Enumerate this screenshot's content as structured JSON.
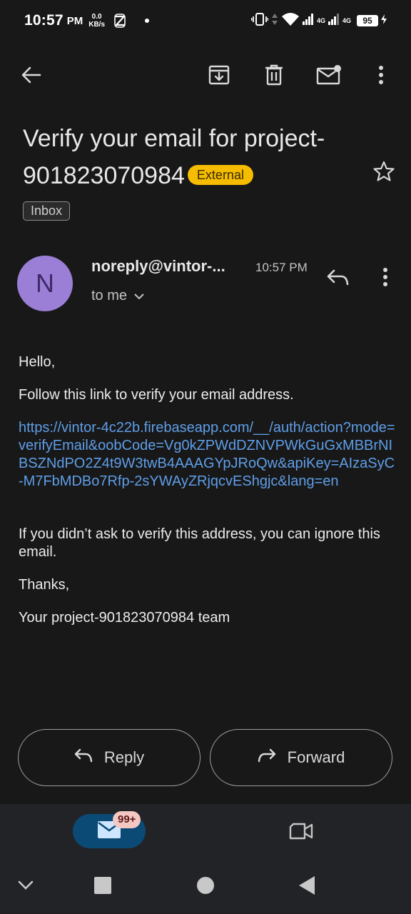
{
  "status_bar": {
    "time": "10:57",
    "ampm": "PM",
    "speed_value": "0.0",
    "speed_unit": "KB/s",
    "net1": "4G",
    "net2": "4G",
    "battery": "95"
  },
  "subject": {
    "title": "Verify your email for project-901823070984",
    "external_label": "External",
    "inbox_label": "Inbox"
  },
  "sender": {
    "avatar_letter": "N",
    "name": "noreply@vintor-...",
    "time": "10:57 PM",
    "recipient": "to me"
  },
  "body": {
    "greeting": "Hello,",
    "line1": "Follow this link to verify your email address.",
    "link": "https://vintor-4c22b.firebaseapp.com/__/auth/action?mode=verifyEmail&oobCode=Vg0kZPWdDZNVPWkGuGxMBBrNIBSZNdPO2Z4t9W3twB4AAAGYpJRoQw&apiKey=AIzaSyC-M7FbMDBo7Rfp-2sYWAyZRjqcvEShgjc&lang=en",
    "ignore_text": "If you didn’t ask to verify this address, you can ignore this email.",
    "thanks": "Thanks,",
    "signature": "Your project-901823070984 team"
  },
  "actions": {
    "reply_label": "Reply",
    "forward_label": "Forward"
  },
  "bottom_nav": {
    "mail_badge": "99+"
  },
  "colors": {
    "background": "#181818",
    "link": "#5f9ee8",
    "external_chip": "#f5bc00",
    "avatar": "#9b7fd6",
    "mail_pill": "#0b4a75"
  },
  "icons": [
    "back-arrow-icon",
    "archive-icon",
    "trash-icon",
    "mark-unread-icon",
    "more-vert-icon",
    "star-icon",
    "reply-icon",
    "chevron-down-icon",
    "forward-icon",
    "mail-icon",
    "video-icon"
  ]
}
